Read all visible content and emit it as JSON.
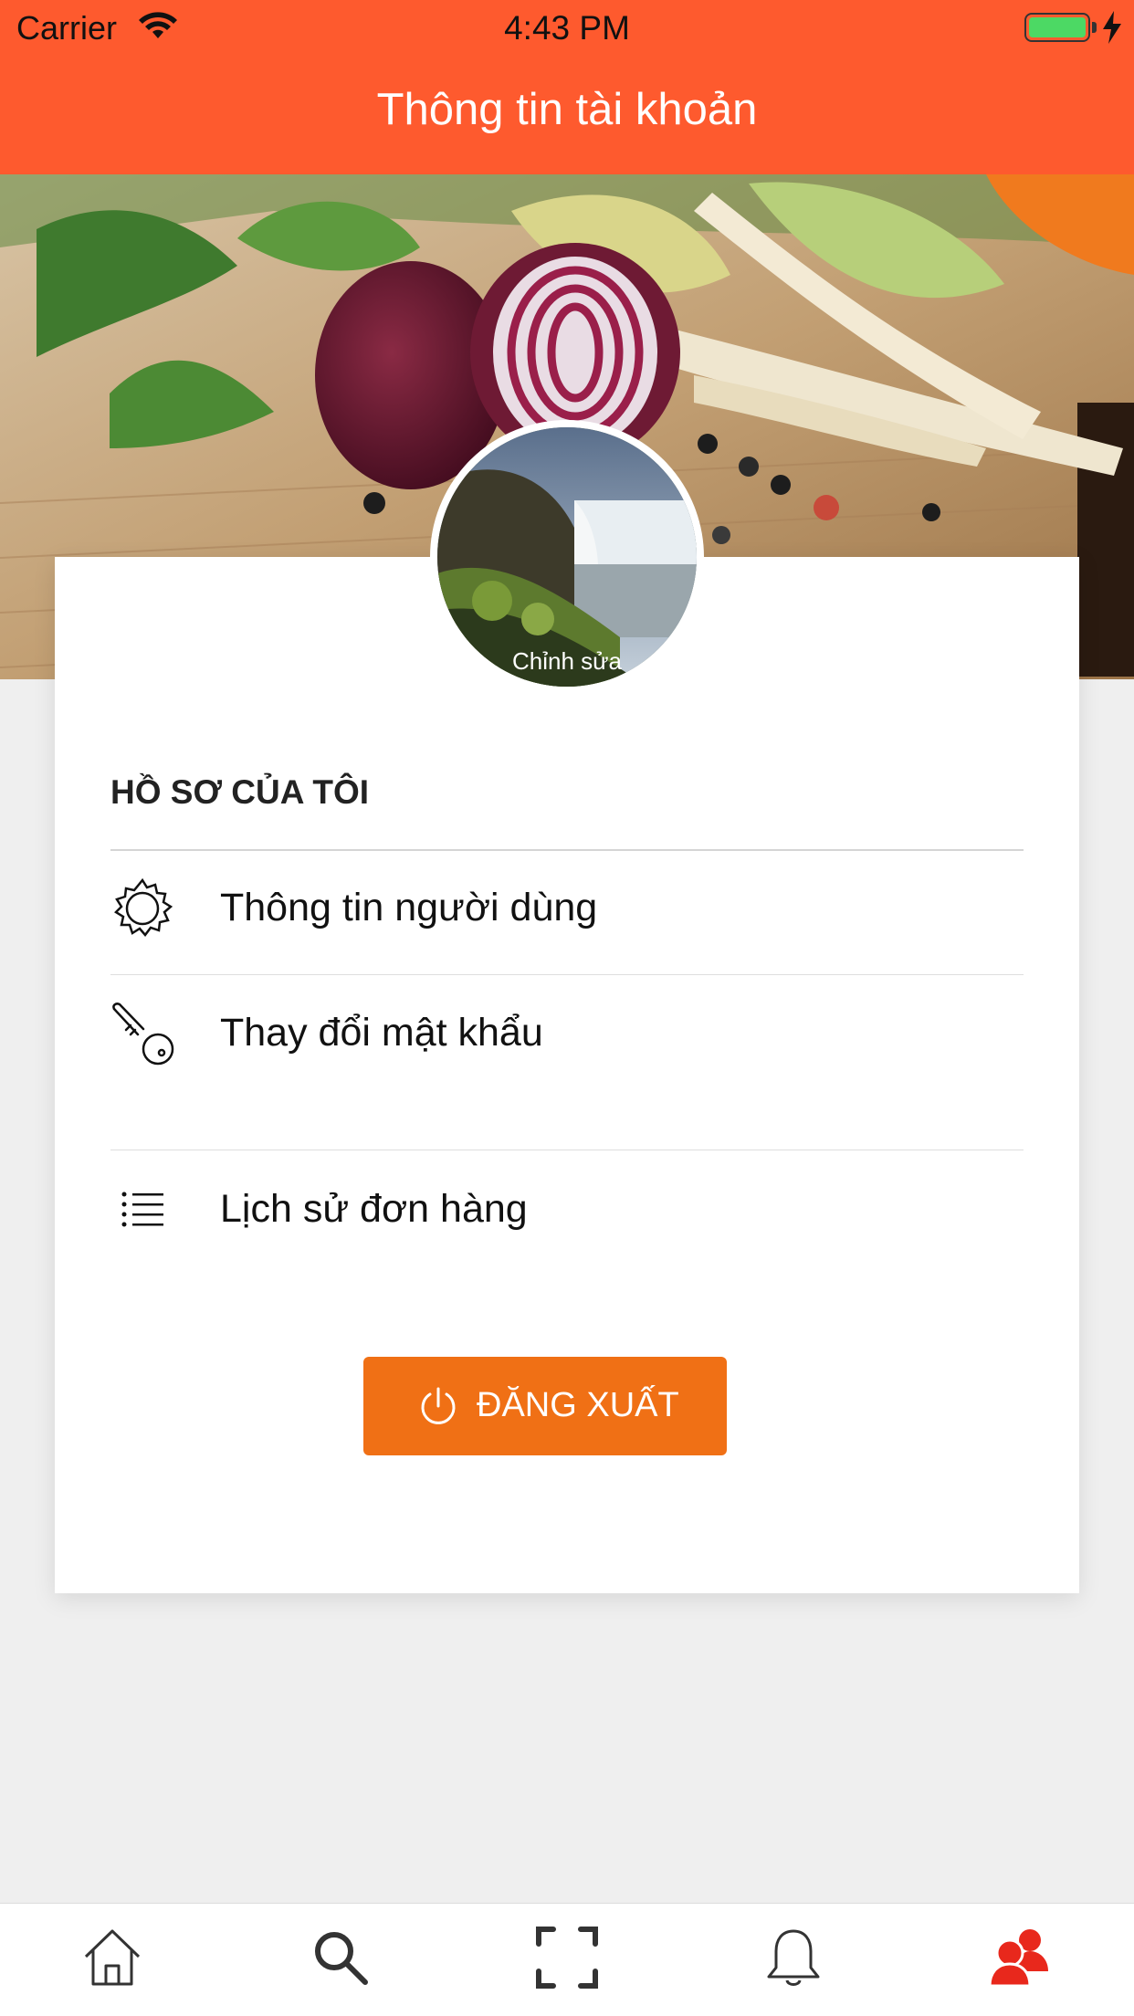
{
  "status_bar": {
    "carrier": "Carrier",
    "time": "4:43 PM"
  },
  "nav": {
    "title": "Thông tin tài khoản"
  },
  "avatar": {
    "edit_label": "Chỉnh sửa"
  },
  "profile": {
    "section_title": "HỒ SƠ CỦA TÔI",
    "items": [
      {
        "label": "Thông tin người dùng",
        "icon": "gear-icon"
      },
      {
        "label": "Thay đổi mật khẩu",
        "icon": "key-icon"
      },
      {
        "label": "Lịch sử đơn hàng",
        "icon": "list-icon"
      }
    ]
  },
  "logout": {
    "label": "ĐĂNG XUẤT",
    "icon": "power-icon"
  },
  "tabbar": {
    "tabs": [
      {
        "icon": "home-icon",
        "active": false
      },
      {
        "icon": "search-icon",
        "active": false
      },
      {
        "icon": "scan-icon",
        "active": false
      },
      {
        "icon": "bell-icon",
        "active": false
      },
      {
        "icon": "users-icon",
        "active": true
      }
    ]
  },
  "colors": {
    "header": "#fe5a2e",
    "logout_button": "#f07015",
    "active_tab": "#e8281c",
    "inactive_tab": "#333333",
    "background": "#efefef"
  }
}
